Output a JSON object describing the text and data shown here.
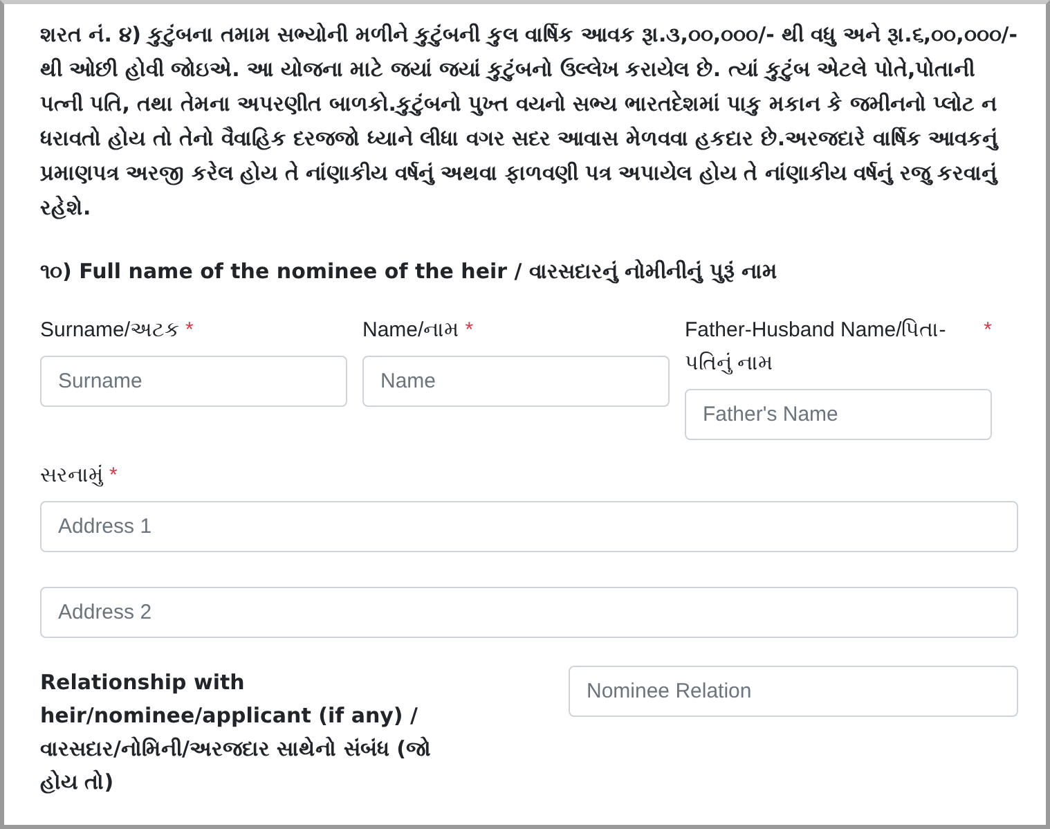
{
  "notice": "શરત નં. ૪) કુટુંબના તમામ સભ્યોની મળીને કુટુંબની કુલ વાર્ષિક આવક રૂા.૩,૦૦,૦૦૦/- થી વધુ અને રૂા.૬,૦૦,૦૦૦/- થી ઓછી હોવી જોઇએ. આ યોજના માટે જયાં જયાં કુટુંબનો ઉલ્લેખ કરાયેલ છે. ત્યાં કુટુંબ એટલે પોતે,પોતાની પત્ની પતિ, તથા તેમના અપરણીત બાળકો.કુટુંબનો પુખ્ત વયનો સભ્ય ભારતદેશમાં પાકુ મકાન કે જમીનનો પ્લોટ ન ધરાવતો હોય તો તેનો વૈવાહિક દરજજો ધ્યાને લીધા વગર સદર આવાસ મેળવવા હકદાર છે.અરજદારે વાર્ષિક આવકનું પ્રમાણપત્ર અરજી કરેલ હોય તે નાંણાકીય વર્ષનું અથવા ફાળવણી પત્ર અપાયેલ હોય તે નાંણાકીય વર્ષનું રજુ કરવાનું રહેશે.",
  "section_heading": "૧૦) Full name of the nominee of the heir / વારસદારનું નોમીનીનું પુરૂં નામ",
  "name_fields": [
    {
      "label": "Surname/અટક",
      "required_mark": "*",
      "placeholder": "Surname"
    },
    {
      "label": "Name/નામ",
      "required_mark": "*",
      "placeholder": "Name"
    },
    {
      "label": "Father-Husband Name/પિતા-પતિનું નામ",
      "required_mark": "*",
      "placeholder": "Father's Name"
    }
  ],
  "address": {
    "label": "સરનામું",
    "required_mark": "*",
    "fields": [
      {
        "placeholder": "Address 1"
      },
      {
        "placeholder": "Address 2"
      }
    ]
  },
  "relationship": {
    "label": "Relationship with heir/nominee/applicant (if any) / વારસદાર/નોમિની/અરજદાર સાથેનો સંબંધ (જો હોય તો)",
    "placeholder": "Nominee Relation"
  }
}
